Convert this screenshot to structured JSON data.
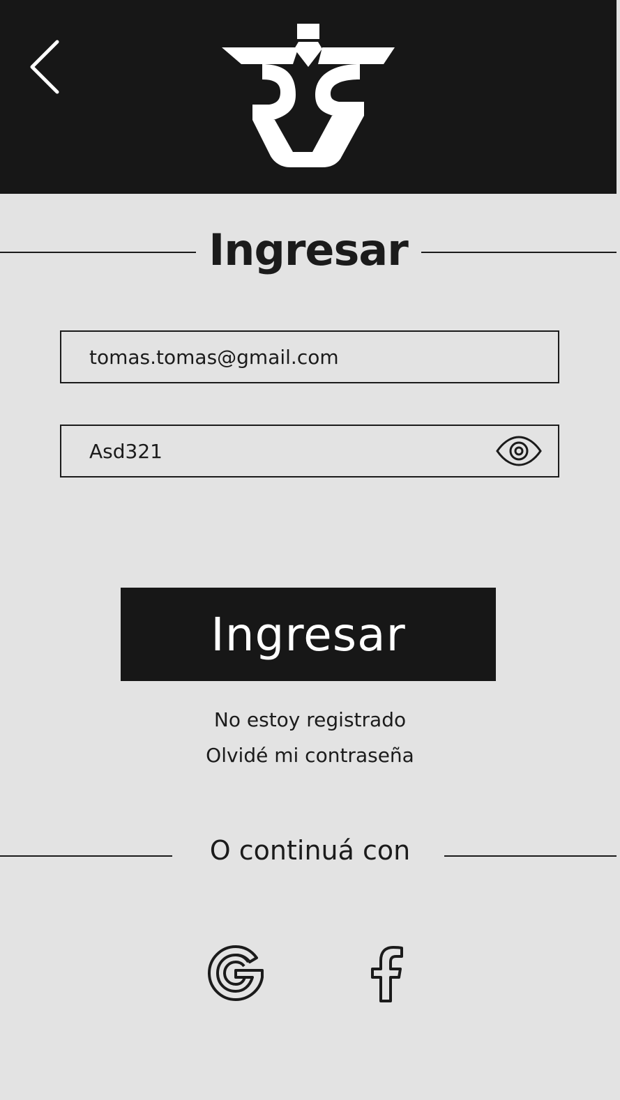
{
  "header": {
    "back_icon": "chevron-left-icon",
    "logo": "brand-logo"
  },
  "login": {
    "title": "Ingresar",
    "email_value": "tomas.tomas@gmail.com",
    "password_value": "Asd321",
    "password_toggle_icon": "eye-icon",
    "submit_label": "Ingresar",
    "register_link": "No estoy registrado",
    "forgot_link": "Olvidé mi contraseña"
  },
  "social": {
    "divider_label": "O continuá con",
    "providers": [
      {
        "name": "Google",
        "icon": "google-icon"
      },
      {
        "name": "Facebook",
        "icon": "facebook-icon"
      }
    ]
  },
  "colors": {
    "header_bg": "#171717",
    "page_bg": "#e3e3e3",
    "text": "#1b1b1b",
    "button_bg": "#171717",
    "button_text": "#ffffff"
  }
}
